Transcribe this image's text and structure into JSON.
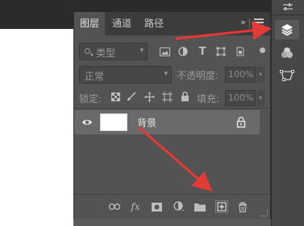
{
  "panel": {
    "tabs": [
      {
        "label": "图层"
      },
      {
        "label": "通道"
      },
      {
        "label": "路径"
      }
    ],
    "more_glyph": "»",
    "filter": {
      "kind_label": "类型"
    },
    "blend_mode": "正常",
    "opacity_label": "不透明度:",
    "opacity_value": "100%",
    "lock_label": "锁定:",
    "fill_label": "填充:",
    "fill_value": "100%",
    "layers": [
      {
        "name": "背景",
        "visible": true,
        "locked": true
      }
    ]
  },
  "annotation_color": "#e53935"
}
